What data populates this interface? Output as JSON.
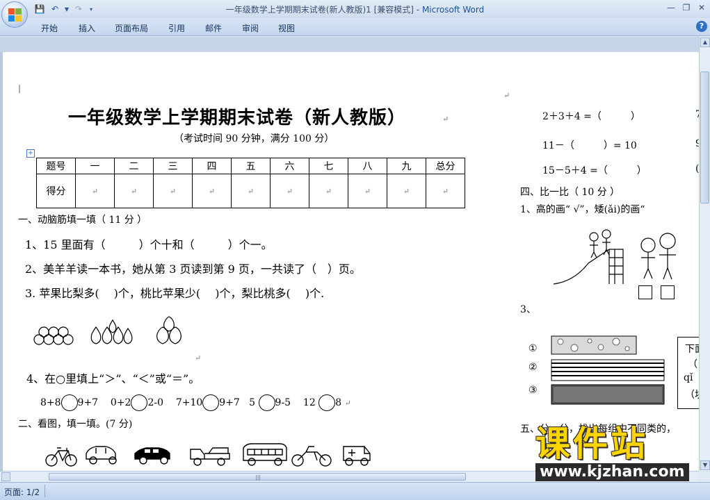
{
  "window": {
    "title": "一年级数学上学期期末试卷(新人教版)1 [兼容模式]",
    "title_sep": " - ",
    "app_name": "Microsoft Word"
  },
  "ribbon": {
    "tabs": [
      "开始",
      "插入",
      "页面布局",
      "引用",
      "邮件",
      "审阅",
      "视图"
    ]
  },
  "document": {
    "title": "一年级数学上学期期末试卷（新人教版）",
    "subtitle": "（考试时间 90 分钟，满分 100 分）",
    "score_table": {
      "headers": [
        "题号",
        "一",
        "二",
        "三",
        "四",
        "五",
        "六",
        "七",
        "八",
        "九",
        "总分"
      ],
      "row_label": "得分"
    },
    "section1": {
      "heading": "一、动脑筋填一填（ 11 分 ）",
      "q1": "1、15 里面有（　　　）个十和（　　　）个一。",
      "q2": "2、美羊羊读一本书，她从第 3 页读到第 9 页，一共读了（　）页。",
      "q3": "3.  苹果比梨多(　 )个，桃比苹果少(　 )个，梨比桃多(　 )个.",
      "q4": "4、在○里填上“＞”、“＜”或“＝”。",
      "q4_items": [
        "8+8",
        "9+7",
        "0+2",
        "2-0",
        "7+10",
        "9+7",
        "5",
        "9-5",
        "12",
        "8"
      ]
    },
    "section2": {
      "heading": "二、看图，填一填。(7 分)"
    },
    "right": {
      "eq1": "2＋3＋4 =（　　　）",
      "eq1_tail": "7",
      "eq2": "11－（　　　）= 10",
      "eq2_tail": "9",
      "eq3": "15－5＋4 =（　　　）",
      "eq3_tail": "(",
      "section4": "四、比一比（ 10 分 ）",
      "s4q1": "1、高的画“ √”，矮(ǎi)的画“",
      "s4q3": "3、",
      "labels": [
        "①",
        "②",
        "③"
      ],
      "box_lines": [
        "下面",
        "（",
        "qǐ",
        "（块"
      ],
      "section5": "五、分一分，找出每组中不同类的，"
    }
  },
  "statusbar": {
    "page": "页面: 1/2"
  },
  "watermark": {
    "text": "课件站",
    "url": "www.kjzhan.com"
  }
}
